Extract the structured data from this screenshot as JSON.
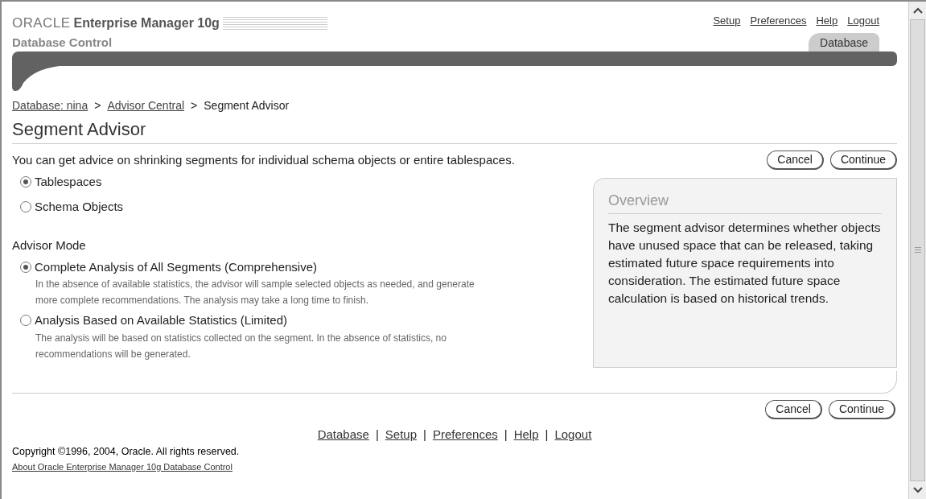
{
  "header": {
    "brand": "ORACLE",
    "product": "Enterprise Manager 10g",
    "subtitle": "Database Control",
    "global_links": [
      "Setup",
      "Preferences",
      "Help",
      "Logout"
    ],
    "tabs": [
      {
        "label": "Database",
        "selected": true
      }
    ]
  },
  "breadcrumb": {
    "links": [
      "Database: nina",
      "Advisor Central"
    ],
    "separator": ">",
    "current": "Segment Advisor"
  },
  "title": "Segment Advisor",
  "description": "You can get advice on shrinking segments for individual schema objects or entire tablespaces.",
  "buttons": [
    "Cancel",
    "Continue"
  ],
  "scope_options": [
    {
      "label": "Tablespaces",
      "selected": true
    },
    {
      "label": "Schema Objects",
      "selected": false
    }
  ],
  "advisor_mode": {
    "label": "Advisor Mode",
    "options": [
      {
        "label": "Complete Analysis of All Segments (Comprehensive)",
        "selected": true,
        "hint": "In the absence of available statistics, the advisor will sample selected objects as needed, and generate more complete recommendations. The analysis may take a long time to finish."
      },
      {
        "label": "Analysis Based on Available Statistics (Limited)",
        "selected": false,
        "hint": "The analysis will be based on statistics collected on the segment. In the absence of statistics, no recommendations will be generated."
      }
    ]
  },
  "overview": {
    "title": "Overview",
    "text": "The segment advisor determines whether objects have unused space that can be released, taking estimated future space requirements into consideration. The estimated future space calculation is based on historical trends."
  },
  "bottom_buttons": [
    "Cancel",
    "Continue"
  ],
  "footer": {
    "links": [
      "Database",
      "Setup",
      "Preferences",
      "Help",
      "Logout"
    ],
    "separator": "|",
    "copyright": "Copyright ©1996, 2004, Oracle. All rights reserved.",
    "about": "About Oracle Enterprise Manager 10g Database Control"
  }
}
